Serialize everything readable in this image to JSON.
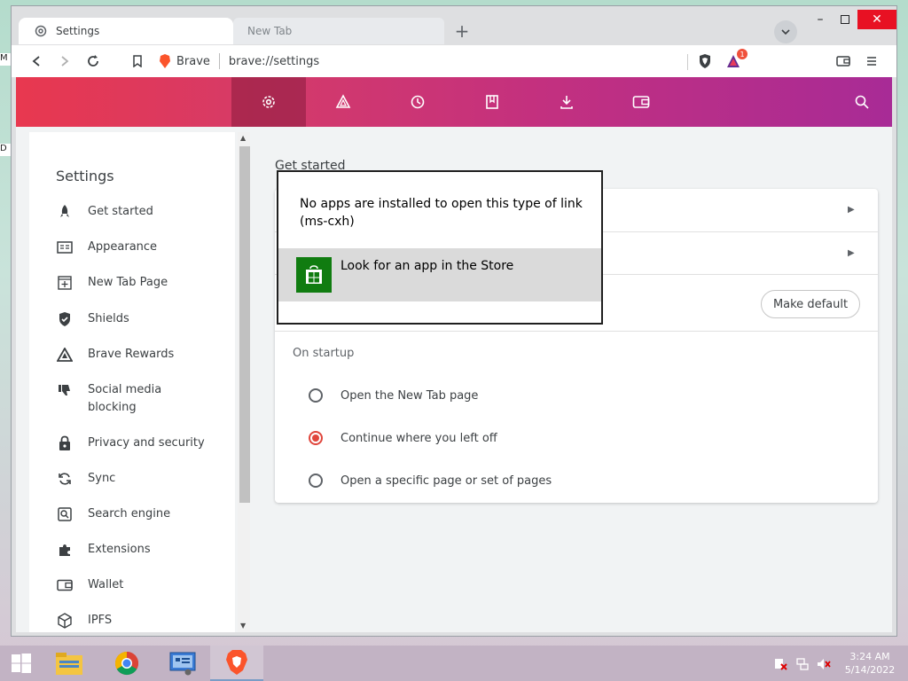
{
  "window": {
    "tabs": [
      {
        "label": "Settings",
        "active": true
      },
      {
        "label": "New Tab",
        "active": false
      }
    ]
  },
  "toolbar": {
    "site_label": "Brave",
    "url": "brave://settings",
    "rewards_badge": "1"
  },
  "header_nav": [
    {
      "name": "settings",
      "icon": "gear-icon",
      "selected": true
    },
    {
      "name": "rewards",
      "icon": "rewards-triangle-icon"
    },
    {
      "name": "history",
      "icon": "history-icon"
    },
    {
      "name": "bookmarks",
      "icon": "bookmark-icon"
    },
    {
      "name": "downloads",
      "icon": "download-icon"
    },
    {
      "name": "wallet",
      "icon": "wallet-icon"
    }
  ],
  "sidebar": {
    "title": "Settings",
    "items": [
      {
        "label": "Get started",
        "icon": "rocket-icon"
      },
      {
        "label": "Appearance",
        "icon": "appearance-icon"
      },
      {
        "label": "New Tab Page",
        "icon": "new-tab-page-icon"
      },
      {
        "label": "Shields",
        "icon": "shield-icon"
      },
      {
        "label": "Brave Rewards",
        "icon": "rewards-triangle-icon"
      },
      {
        "label": "Social media blocking",
        "icon": "thumbs-down-icon"
      },
      {
        "label": "Privacy and security",
        "icon": "lock-icon"
      },
      {
        "label": "Sync",
        "icon": "sync-icon"
      },
      {
        "label": "Search engine",
        "icon": "search-engine-icon"
      },
      {
        "label": "Extensions",
        "icon": "puzzle-icon"
      },
      {
        "label": "Wallet",
        "icon": "wallet-icon"
      },
      {
        "label": "IPFS",
        "icon": "cube-icon"
      }
    ]
  },
  "main": {
    "section_title": "Get started",
    "make_default_label": "Make default",
    "startup_label": "On startup",
    "startup_options": [
      {
        "label": "Open the New Tab page",
        "checked": false
      },
      {
        "label": "Continue where you left off",
        "checked": true
      },
      {
        "label": "Open a specific page or set of pages",
        "checked": false
      }
    ]
  },
  "dialog": {
    "message": "No apps are installed to open this type of link (ms-cxh)",
    "option_label": "Look for an app in the Store"
  },
  "taskbar": {
    "apps": [
      "file-explorer-icon",
      "chrome-icon",
      "control-panel-icon",
      "brave-icon"
    ],
    "time": "3:24 AM",
    "date": "5/14/2022"
  },
  "colors": {
    "accent_radio": "#e0463c",
    "header_gradient_start": "#e8384f",
    "header_gradient_end": "#a82b96",
    "store_green": "#107c10"
  }
}
